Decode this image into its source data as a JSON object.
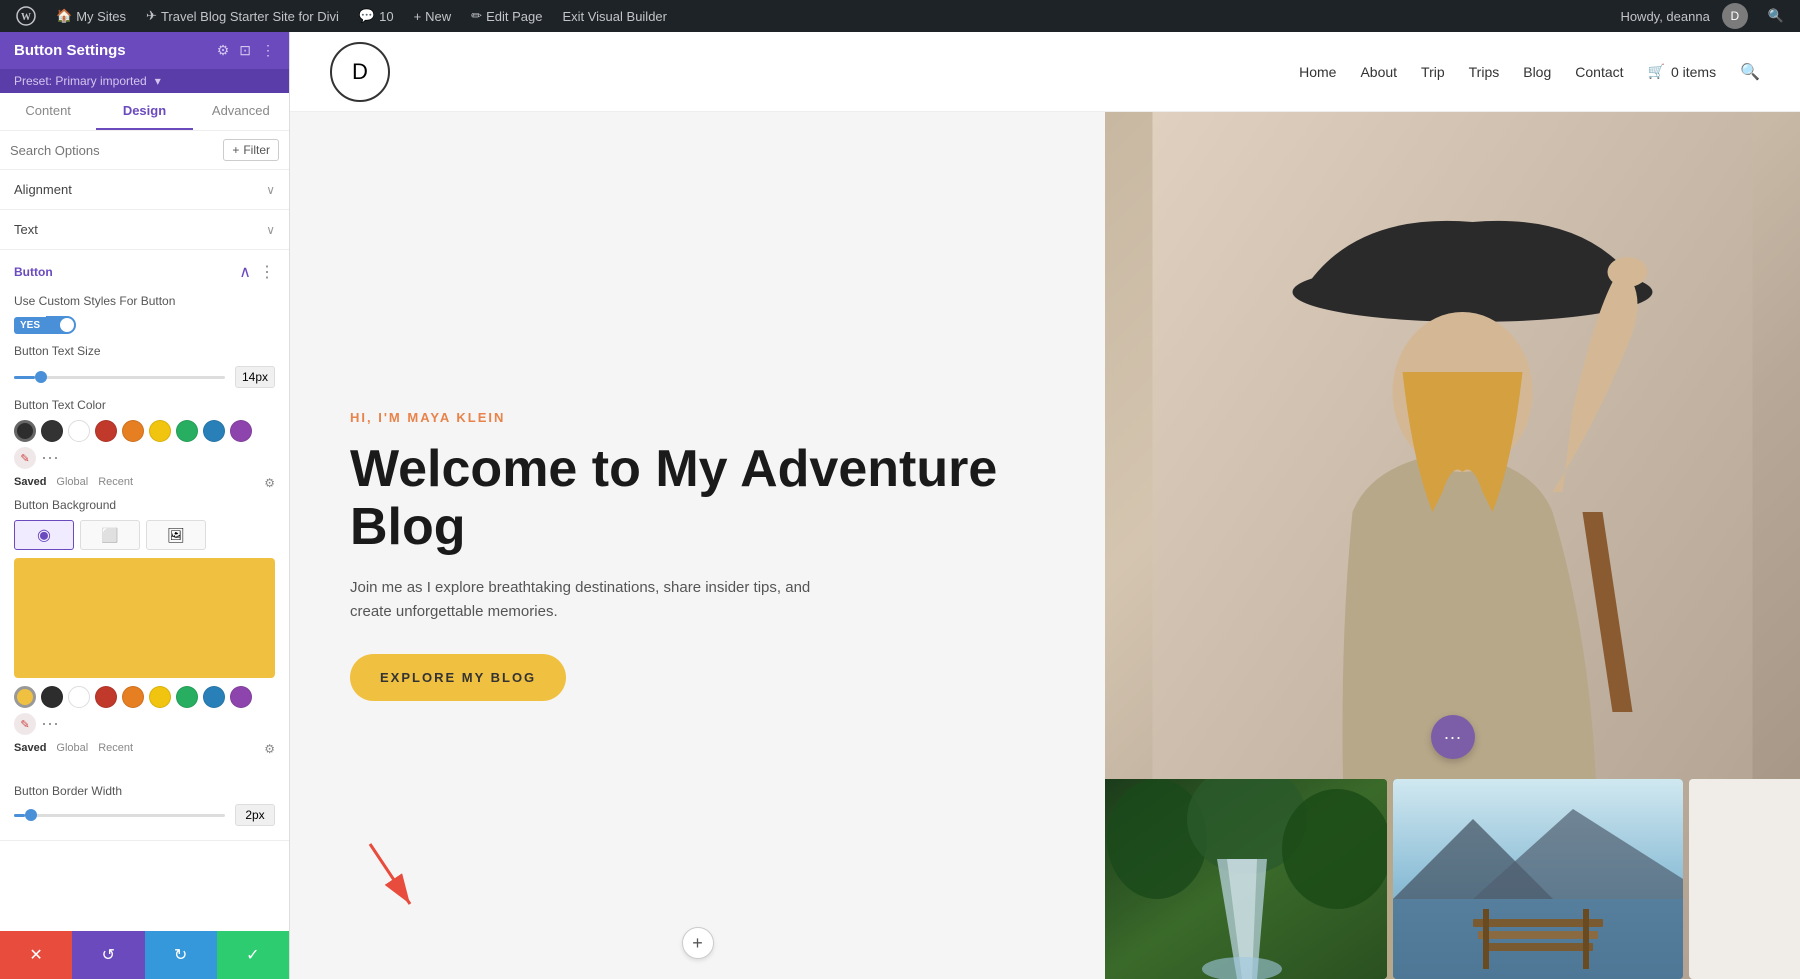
{
  "adminBar": {
    "wpIcon": "⊕",
    "mySites": "My Sites",
    "travelBlog": "Travel Blog Starter Site for Divi",
    "comments": "10",
    "newLabel": "New",
    "editPage": "Edit Page",
    "exitBuilder": "Exit Visual Builder",
    "howdy": "Howdy, deanna",
    "counterIcon": "💬"
  },
  "panel": {
    "title": "Button Settings",
    "preset": "Preset: Primary imported",
    "tabs": [
      "Content",
      "Design",
      "Advanced"
    ],
    "activeTab": "Design",
    "searchPlaceholder": "Search Options",
    "filterLabel": "+ Filter",
    "sections": {
      "alignment": "Alignment",
      "text": "Text",
      "button": "Button"
    },
    "button": {
      "sectionTitle": "Button",
      "customStyles": "Use Custom Styles For Button",
      "customStylesEnabled": "YES",
      "textSizeLabel": "Button Text Size",
      "textSizeValue": "14px",
      "textColorLabel": "Button Text Color",
      "colorSwatches": [
        {
          "color": "#2d2d2d",
          "id": "black"
        },
        {
          "color": "#333333",
          "id": "darkgray"
        },
        {
          "color": "#ffffff",
          "id": "white"
        },
        {
          "color": "#c0392b",
          "id": "red"
        },
        {
          "color": "#e67e22",
          "id": "orange"
        },
        {
          "color": "#f1c40f",
          "id": "yellow"
        },
        {
          "color": "#27ae60",
          "id": "green"
        },
        {
          "color": "#2980b9",
          "id": "blue"
        },
        {
          "color": "#8e44ad",
          "id": "purple"
        }
      ],
      "colorMeta": [
        "Saved",
        "Global",
        "Recent"
      ],
      "bgLabel": "Button Background",
      "bgColor": "#f0c040",
      "bgSwatches": [
        {
          "color": "#f0c040",
          "id": "yellow-sel"
        },
        {
          "color": "#2d2d2d",
          "id": "black2"
        },
        {
          "color": "#ffffff",
          "id": "white2"
        },
        {
          "color": "#c0392b",
          "id": "red2"
        },
        {
          "color": "#e67e22",
          "id": "orange2"
        },
        {
          "color": "#f1c40f",
          "id": "yellow2"
        },
        {
          "color": "#27ae60",
          "id": "green2"
        },
        {
          "color": "#2980b9",
          "id": "blue2"
        },
        {
          "color": "#8e44ad",
          "id": "purple2"
        }
      ],
      "borderWidthLabel": "Button Border Width",
      "borderWidthValue": "2px"
    },
    "actions": {
      "cancel": "✕",
      "reset": "↺",
      "redo": "↻",
      "save": "✓"
    }
  },
  "siteHeader": {
    "logo": "D",
    "nav": [
      "Home",
      "About",
      "Trip",
      "Trips",
      "Blog",
      "Contact"
    ],
    "cartLabel": "0 items",
    "cartIcon": "🛒"
  },
  "hero": {
    "tag": "HI, I'M MAYA KLEIN",
    "title": "Welcome to My Adventure Blog",
    "subtitle": "Join me as I explore breathtaking destinations, share insider tips, and create unforgettable memories.",
    "ctaLabel": "EXPLORE MY BLOG"
  }
}
